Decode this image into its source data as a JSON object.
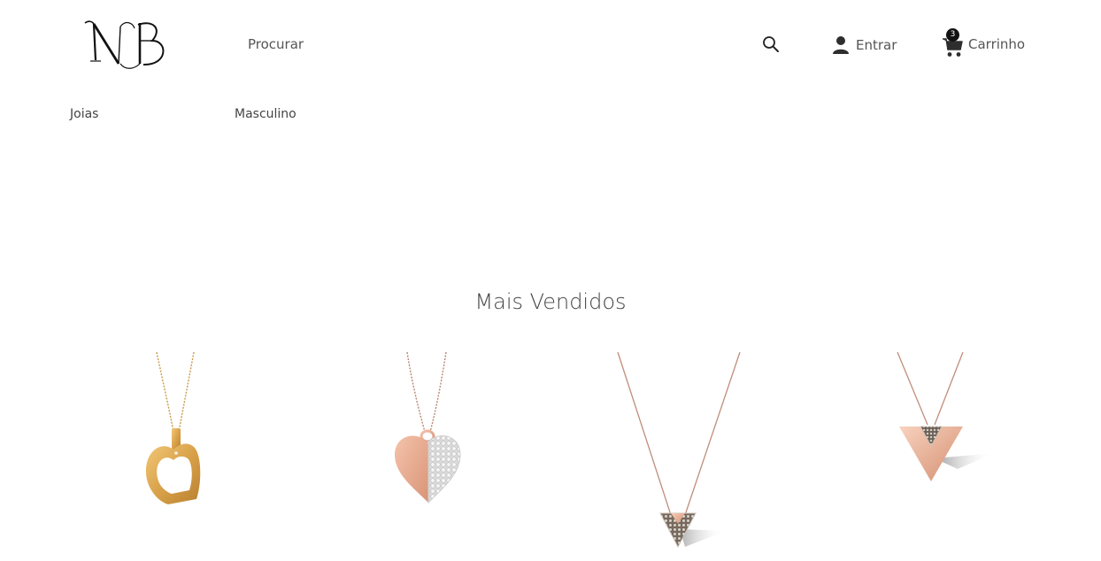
{
  "header": {
    "logo_text": "NB",
    "search_label": "Procurar",
    "login_label": "Entrar",
    "cart_label": "Carrinho",
    "cart_count": "3"
  },
  "nav": {
    "items": [
      {
        "label": "Joias"
      },
      {
        "label": "Masculino"
      }
    ]
  },
  "section": {
    "title": "Mais Vendidos"
  },
  "products": [
    {
      "icon": "gold-open-heart-pendant-image"
    },
    {
      "icon": "rose-gold-diamond-heart-pendant-image"
    },
    {
      "icon": "rose-gold-diamond-triangle-pendant-image"
    },
    {
      "icon": "rose-gold-triangle-pendant-image"
    }
  ],
  "colors": {
    "text": "#555555",
    "badge": "#111111",
    "gold": "#d9a24a",
    "rose_gold": "#e3a88c"
  }
}
